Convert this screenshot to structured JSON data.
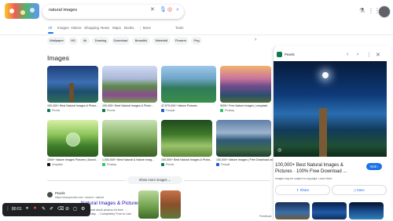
{
  "search": {
    "query": "natural images"
  },
  "tabs": [
    "All",
    "Images",
    "Videos",
    "Shopping",
    "News",
    "Maps",
    "Books",
    "More"
  ],
  "tools_label": "Tools",
  "chips": [
    "Wallpaper",
    "HD",
    "4k",
    "Drawing",
    "Download",
    "Beautiful",
    "Waterfall",
    "Flowers",
    "Png"
  ],
  "images_section": {
    "title": "Images",
    "items": [
      {
        "caption": "100,000+ Best Natural Images & Pictur...",
        "source": "Pexels"
      },
      {
        "caption": "100,000+ Best Natural Images & Pictur...",
        "source": "Pexels"
      },
      {
        "caption": "47,579,000+ Nature Pictures",
        "source": "Freepik"
      },
      {
        "caption": "9000+ Free Nature Images | unsplash",
        "source": "Pixabay"
      },
      {
        "caption": "1000+ Nature Images Pictures | Downl...",
        "source": "Unsplash"
      },
      {
        "caption": "1,000,000+ Best Natural & Nature Imag...",
        "source": "Pixabay"
      },
      {
        "caption": "100,000+ Best Natural Images & Pictur...",
        "source": "Pexels"
      },
      {
        "caption": "100,000+ Nature Images | Free Download on Fre...",
        "source": "Freepik"
      }
    ],
    "show_more": "Show more images"
  },
  "result": {
    "site": "Pexels",
    "url": "https://www.pexels.com › search › natural",
    "title": "Natural Images & Pictures",
    "snippet": "Download and use 100,000+ natural stock photos for free. ... Thousands of new images every day ... Completely Free to Use"
  },
  "toolbar": {
    "time": "00:01"
  },
  "panel": {
    "source": "Pexels",
    "title": "100,000+ Best Natural Images & Pictures · 100% Free Download ...",
    "visit": "Visit",
    "note": "Images may be subject to copyright. Learn More",
    "share": "Share",
    "save": "Save"
  },
  "feedback": "Feedback"
}
